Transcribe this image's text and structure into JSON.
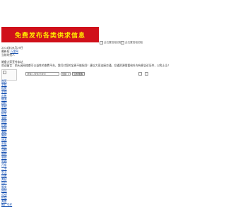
{
  "banner": {
    "text": "免费发布各类供求信息"
  },
  "ads": {
    "left_alt": "此位置招租招租",
    "right_alt": "此位置招租招租"
  },
  "header": {
    "date": "2014年09月29日",
    "login_prefix": "最新招",
    "login_link": "万里网",
    "site_line": "当前的招人",
    "intro": "婚备大家宣传本站",
    "notice": "欢迎留言：前天因网络都可公益性的收费平台，我们对您的宝贵不能指导！建议大家连接交通，交通资源需要给外方有损告诉证件，以免上当！"
  },
  "search": {
    "placeholder": "请输入搜索关键字",
    "category": "全部",
    "button": "立即搜索"
  },
  "nav": {
    "items": [
      "首页",
      "求租",
      "租房",
      "求购",
      "出售",
      "物流",
      "建材",
      "家政",
      "教育",
      "招生",
      "兼职",
      "维修",
      "招聘",
      "求职",
      "兼职",
      "婚庆",
      "旅游",
      "家居",
      "餐饮",
      "宠物",
      "服装",
      "装修",
      "电器",
      "汽车",
      "二手",
      "农业",
      "回收",
      "美容",
      "设计",
      "服务",
      "网站",
      "活动",
      "招商",
      "美食",
      "推广专栏"
    ]
  }
}
